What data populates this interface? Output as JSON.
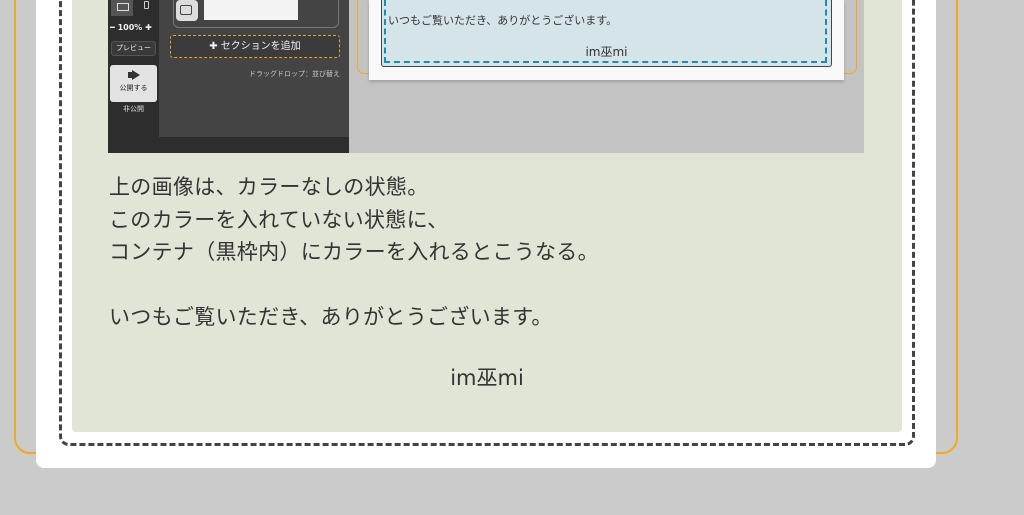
{
  "screenshot": {
    "sidebar": {
      "zoom": "━ 100% ✚",
      "preview_label": "プレビュー",
      "publish_label": "公開する",
      "unpublished_label": "非公開"
    },
    "add_section_label": "セクションを追加",
    "drag_drop_note": "ドラッグドロップ：並び替え",
    "preview_text": "いつもご覧いただき、ありがとうございます。",
    "preview_signature": "im巫mi"
  },
  "article": {
    "lines": [
      "上の画像は、カラーなしの状態。",
      "このカラーを入れていない状態に、",
      "コンテナ（黒枠内）にカラーを入れるとこうなる。"
    ],
    "thanks": "いつもご覧いただき、ありがとうございます。",
    "signature": "im巫mi"
  },
  "colors": {
    "page_bg": "#cbcbcb",
    "container_bg": "#e1e5d6",
    "orange_border": "#f0aa1e",
    "dashed_border": "#444444",
    "preview_blue": "#d5e4e8",
    "preview_dash": "#1f8cae"
  }
}
